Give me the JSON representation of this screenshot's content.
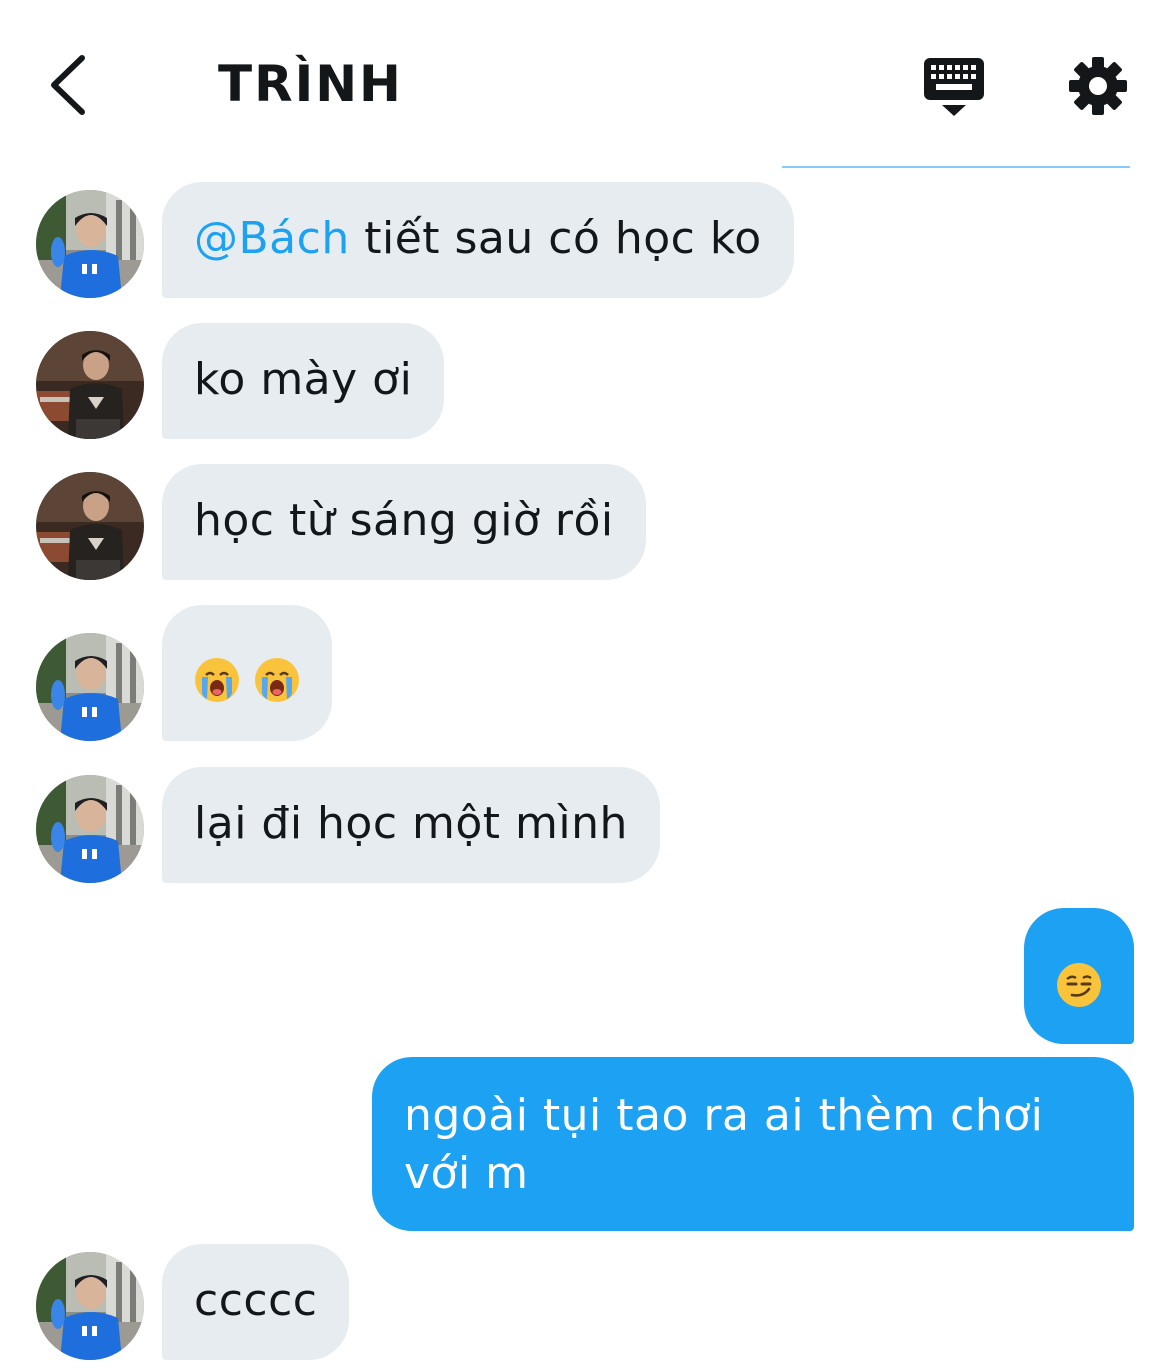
{
  "header": {
    "title": "TRÌNH",
    "back_icon": "chevron-left-icon",
    "keyboard_icon": "keyboard-dismiss-icon",
    "settings_icon": "gear-icon"
  },
  "colors": {
    "accent": "#1da1f2",
    "incoming_bubble": "#e6ecf0",
    "text": "#14171a"
  },
  "messages": [
    {
      "direction": "in",
      "avatar": "avatar-blue-shirt",
      "mention": "@Bách",
      "text": " tiết sau có học ko"
    },
    {
      "direction": "in",
      "avatar": "avatar-dark-shirt",
      "text": "ko mày ơi"
    },
    {
      "direction": "in",
      "avatar": "avatar-dark-shirt",
      "text": "học từ sáng giờ rồi"
    },
    {
      "direction": "in",
      "avatar": "avatar-blue-shirt",
      "emojis": [
        "loudly-crying-face",
        "loudly-crying-face"
      ]
    },
    {
      "direction": "in",
      "avatar": "avatar-blue-shirt",
      "text": "lại đi học một mình"
    },
    {
      "direction": "out",
      "emojis": [
        "smirking-face"
      ]
    },
    {
      "direction": "out",
      "text": "ngoài tụi tao ra ai thèm chơi với m"
    },
    {
      "direction": "in",
      "avatar": "avatar-blue-shirt",
      "text": "ccccc"
    }
  ]
}
